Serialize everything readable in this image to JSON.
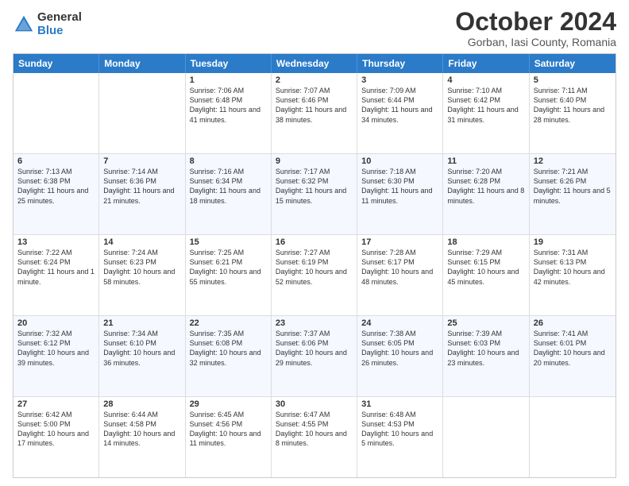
{
  "logo": {
    "general": "General",
    "blue": "Blue"
  },
  "title": "October 2024",
  "location": "Gorban, Iasi County, Romania",
  "weekdays": [
    "Sunday",
    "Monday",
    "Tuesday",
    "Wednesday",
    "Thursday",
    "Friday",
    "Saturday"
  ],
  "weeks": [
    [
      {
        "day": "",
        "info": ""
      },
      {
        "day": "",
        "info": ""
      },
      {
        "day": "1",
        "info": "Sunrise: 7:06 AM\nSunset: 6:48 PM\nDaylight: 11 hours and 41 minutes."
      },
      {
        "day": "2",
        "info": "Sunrise: 7:07 AM\nSunset: 6:46 PM\nDaylight: 11 hours and 38 minutes."
      },
      {
        "day": "3",
        "info": "Sunrise: 7:09 AM\nSunset: 6:44 PM\nDaylight: 11 hours and 34 minutes."
      },
      {
        "day": "4",
        "info": "Sunrise: 7:10 AM\nSunset: 6:42 PM\nDaylight: 11 hours and 31 minutes."
      },
      {
        "day": "5",
        "info": "Sunrise: 7:11 AM\nSunset: 6:40 PM\nDaylight: 11 hours and 28 minutes."
      }
    ],
    [
      {
        "day": "6",
        "info": "Sunrise: 7:13 AM\nSunset: 6:38 PM\nDaylight: 11 hours and 25 minutes."
      },
      {
        "day": "7",
        "info": "Sunrise: 7:14 AM\nSunset: 6:36 PM\nDaylight: 11 hours and 21 minutes."
      },
      {
        "day": "8",
        "info": "Sunrise: 7:16 AM\nSunset: 6:34 PM\nDaylight: 11 hours and 18 minutes."
      },
      {
        "day": "9",
        "info": "Sunrise: 7:17 AM\nSunset: 6:32 PM\nDaylight: 11 hours and 15 minutes."
      },
      {
        "day": "10",
        "info": "Sunrise: 7:18 AM\nSunset: 6:30 PM\nDaylight: 11 hours and 11 minutes."
      },
      {
        "day": "11",
        "info": "Sunrise: 7:20 AM\nSunset: 6:28 PM\nDaylight: 11 hours and 8 minutes."
      },
      {
        "day": "12",
        "info": "Sunrise: 7:21 AM\nSunset: 6:26 PM\nDaylight: 11 hours and 5 minutes."
      }
    ],
    [
      {
        "day": "13",
        "info": "Sunrise: 7:22 AM\nSunset: 6:24 PM\nDaylight: 11 hours and 1 minute."
      },
      {
        "day": "14",
        "info": "Sunrise: 7:24 AM\nSunset: 6:23 PM\nDaylight: 10 hours and 58 minutes."
      },
      {
        "day": "15",
        "info": "Sunrise: 7:25 AM\nSunset: 6:21 PM\nDaylight: 10 hours and 55 minutes."
      },
      {
        "day": "16",
        "info": "Sunrise: 7:27 AM\nSunset: 6:19 PM\nDaylight: 10 hours and 52 minutes."
      },
      {
        "day": "17",
        "info": "Sunrise: 7:28 AM\nSunset: 6:17 PM\nDaylight: 10 hours and 48 minutes."
      },
      {
        "day": "18",
        "info": "Sunrise: 7:29 AM\nSunset: 6:15 PM\nDaylight: 10 hours and 45 minutes."
      },
      {
        "day": "19",
        "info": "Sunrise: 7:31 AM\nSunset: 6:13 PM\nDaylight: 10 hours and 42 minutes."
      }
    ],
    [
      {
        "day": "20",
        "info": "Sunrise: 7:32 AM\nSunset: 6:12 PM\nDaylight: 10 hours and 39 minutes."
      },
      {
        "day": "21",
        "info": "Sunrise: 7:34 AM\nSunset: 6:10 PM\nDaylight: 10 hours and 36 minutes."
      },
      {
        "day": "22",
        "info": "Sunrise: 7:35 AM\nSunset: 6:08 PM\nDaylight: 10 hours and 32 minutes."
      },
      {
        "day": "23",
        "info": "Sunrise: 7:37 AM\nSunset: 6:06 PM\nDaylight: 10 hours and 29 minutes."
      },
      {
        "day": "24",
        "info": "Sunrise: 7:38 AM\nSunset: 6:05 PM\nDaylight: 10 hours and 26 minutes."
      },
      {
        "day": "25",
        "info": "Sunrise: 7:39 AM\nSunset: 6:03 PM\nDaylight: 10 hours and 23 minutes."
      },
      {
        "day": "26",
        "info": "Sunrise: 7:41 AM\nSunset: 6:01 PM\nDaylight: 10 hours and 20 minutes."
      }
    ],
    [
      {
        "day": "27",
        "info": "Sunrise: 6:42 AM\nSunset: 5:00 PM\nDaylight: 10 hours and 17 minutes."
      },
      {
        "day": "28",
        "info": "Sunrise: 6:44 AM\nSunset: 4:58 PM\nDaylight: 10 hours and 14 minutes."
      },
      {
        "day": "29",
        "info": "Sunrise: 6:45 AM\nSunset: 4:56 PM\nDaylight: 10 hours and 11 minutes."
      },
      {
        "day": "30",
        "info": "Sunrise: 6:47 AM\nSunset: 4:55 PM\nDaylight: 10 hours and 8 minutes."
      },
      {
        "day": "31",
        "info": "Sunrise: 6:48 AM\nSunset: 4:53 PM\nDaylight: 10 hours and 5 minutes."
      },
      {
        "day": "",
        "info": ""
      },
      {
        "day": "",
        "info": ""
      }
    ]
  ]
}
